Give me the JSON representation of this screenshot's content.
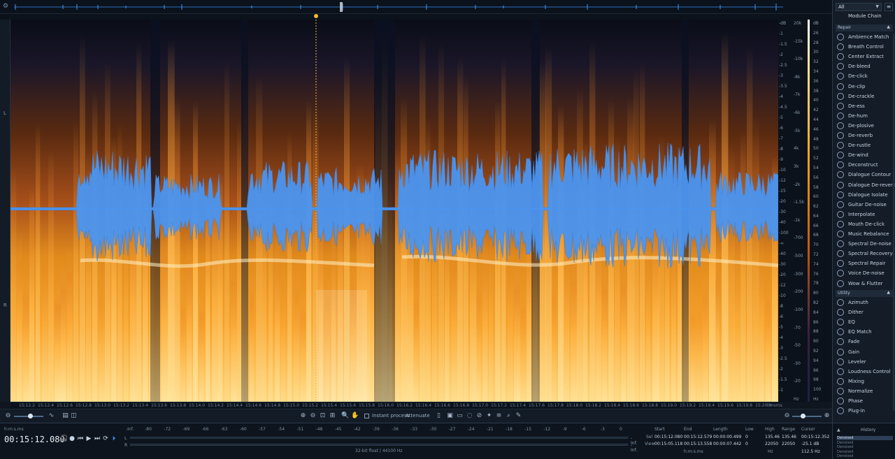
{
  "overview": {},
  "channels": {
    "left": "L",
    "right": "R"
  },
  "freq_ruler": {
    "left_ticks": [
      "-dB",
      "-1",
      "-1.5",
      "-2",
      "-2.5",
      "-3",
      "-3.5",
      "-4",
      "-4.5",
      "-5",
      "-6",
      "-7",
      "-8",
      "-9",
      "-10",
      "-12",
      "-15",
      "-20",
      "-30",
      "-40",
      "-100",
      "-∞",
      "-40",
      "-30",
      "-20",
      "-12",
      "-10",
      "-8",
      "-6",
      "-5",
      "-4",
      "-3",
      "-2.5",
      "-2",
      "-1.5",
      "-1"
    ],
    "hz_ticks": [
      "20k",
      "-15k",
      "-10k",
      "-8k",
      "-7k",
      "-6k",
      "-5k",
      "4k",
      "3k",
      "-2k",
      "-1.5k",
      "-1k",
      "-700",
      "-500",
      "-300",
      "-200",
      "-100",
      "-70",
      "-50",
      "-30",
      "-20",
      "Hz"
    ],
    "db_ticks": [
      "dB",
      "26",
      "28",
      "30",
      "32",
      "34",
      "36",
      "38",
      "40",
      "42",
      "44",
      "46",
      "48",
      "50",
      "52",
      "54",
      "56",
      "58",
      "60",
      "62",
      "64",
      "66",
      "68",
      "70",
      "72",
      "74",
      "76",
      "78",
      "80",
      "82",
      "84",
      "86",
      "88",
      "90",
      "92",
      "94",
      "96",
      "98",
      "100",
      "Hz"
    ]
  },
  "timeline": {
    "labels": [
      "15:12.2",
      "15:12.4",
      "15:12.6",
      "15:12.8",
      "15:13.0",
      "15:13.2",
      "15:13.4",
      "15:13.6",
      "15:13.8",
      "15:14.0",
      "15:14.2",
      "15:14.4",
      "15:14.6",
      "15:14.8",
      "15:15.0",
      "15:15.2",
      "15:15.4",
      "15:15.6",
      "15:15.8",
      "15:16.0",
      "15:16.2",
      "15:16.4",
      "15:16.6",
      "15:16.8",
      "15:17.0",
      "15:17.2",
      "15:17.4",
      "15:17.6",
      "15:17.8",
      "15:18.0",
      "15:18.2",
      "15:18.4",
      "15:18.6",
      "15:18.8",
      "15:19.0",
      "15:19.2",
      "15:19.4",
      "15:19.6",
      "15:19.8",
      "15:20.0"
    ],
    "end": "hmsms"
  },
  "toolbar": {
    "instant_process": "Instant process",
    "attenuate": "Attenuate"
  },
  "transport": {
    "time_format": "h:m:s.ms",
    "timecode": "00:15:12.080",
    "meter_scale": [
      "-Inf.",
      "-80",
      "-72",
      "-69",
      "-66",
      "-63",
      "-60",
      "-57",
      "-54",
      "-51",
      "-48",
      "-45",
      "-42",
      "-39",
      "-36",
      "-33",
      "-30",
      "-27",
      "-24",
      "-21",
      "-18",
      "-15",
      "-12",
      "-9",
      "-6",
      "-3",
      "0"
    ],
    "left": "L",
    "right": "R",
    "inf_top": "-Inf.",
    "inf_bottom": "-Inf.",
    "format": "32-bit float | 44100 Hz"
  },
  "selection": {
    "headers": {
      "start": "Start",
      "end": "End",
      "length": "Length",
      "low": "Low",
      "high": "High",
      "range": "Range",
      "cursor": "Cursor"
    },
    "sel_label": "Sel",
    "view_label": "View",
    "sel": {
      "start": "00:15:12.080",
      "end": "00:15:12.579",
      "length": "00:00:00.499",
      "low": "0",
      "high": "135.46",
      "range": "135.46"
    },
    "view": {
      "start": "00:15:05.118",
      "end": "00:15:13.558",
      "length": "00:00:07.442",
      "low": "0",
      "high": "22050",
      "range": "22050"
    },
    "cursor": {
      "time": "00:15:12.352",
      "db": "-25.1 dB",
      "hz": "112.5 Hz"
    },
    "units_time": "h:m:s.ms",
    "units_hz": "Hz"
  },
  "panel": {
    "filter": "All",
    "module_chain": "Module Chain",
    "repair_label": "Repair",
    "utility_label": "Utility",
    "repair_modules": [
      "Ambience Match",
      "Breath Control",
      "Center Extract",
      "De-bleed",
      "De-click",
      "De-clip",
      "De-crackle",
      "De-ess",
      "De-hum",
      "De-plosive",
      "De-reverb",
      "De-rustle",
      "De-wind",
      "Deconstruct",
      "Dialogue Contour",
      "Dialogue De-reverb",
      "Dialogue Isolate",
      "Guitar De-noise",
      "Interpolate",
      "Mouth De-click",
      "Music Rebalance",
      "Spectral De-noise",
      "Spectral Recovery",
      "Spectral Repair",
      "Voice De-noise",
      "Wow & Flutter"
    ],
    "utility_modules": [
      "Azimuth",
      "Dither",
      "EQ",
      "EQ Match",
      "Fade",
      "Gain",
      "Leveler",
      "Loudness Control",
      "Mixing",
      "Normalize",
      "Phase",
      "Plug-in"
    ]
  },
  "history": {
    "title": "History",
    "items": [
      "Denoised",
      "Denoised",
      "Denoised",
      "Denoised",
      "Denoised"
    ]
  },
  "colors": {
    "accent": "#3b8df0",
    "waveform": "#4a95f0",
    "marker": "#f4b43c"
  }
}
